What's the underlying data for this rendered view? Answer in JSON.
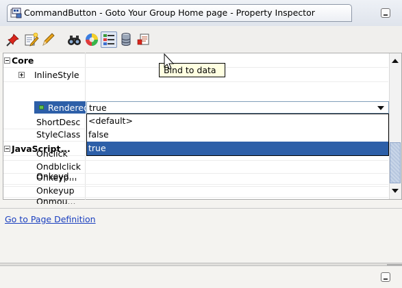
{
  "window": {
    "title": "CommandButton - Goto Your Group Home page - Property Inspector"
  },
  "toolbar": {
    "buttons": [
      {
        "icon": "pushpin-icon"
      },
      {
        "icon": "edit-properties-icon"
      },
      {
        "icon": "pencil-icon"
      },
      {
        "icon": "binoculars-icon"
      },
      {
        "icon": "color-wheel-icon"
      },
      {
        "icon": "categorized-list-icon"
      },
      {
        "icon": "database-bind-icon"
      },
      {
        "icon": "document-icon"
      }
    ]
  },
  "tooltip": {
    "text": "Bind to data"
  },
  "grid": {
    "categories": [
      {
        "label": "Core"
      },
      {
        "label": "JavaScript..."
      }
    ],
    "rows": [
      {
        "label": "InlineStyle"
      },
      {
        "label": "Rendered",
        "value": "true"
      },
      {
        "label": "ShortDesc"
      },
      {
        "label": "StyleClass"
      },
      {
        "label": "Onclick"
      },
      {
        "label": "Ondblclick"
      },
      {
        "label": "Onkeyd..."
      },
      {
        "label": "Onkeyp..."
      },
      {
        "label": "Onkeyup"
      },
      {
        "label": "Onmou..."
      }
    ]
  },
  "dropdown": {
    "options": [
      "<default>",
      "false",
      "true"
    ],
    "selected": "true"
  },
  "footer": {
    "link": "Go to Page Definition"
  },
  "colors": {
    "selection": "#2d5fa8",
    "link": "#1a3fbf",
    "tooltip_bg": "#ffffe1"
  }
}
